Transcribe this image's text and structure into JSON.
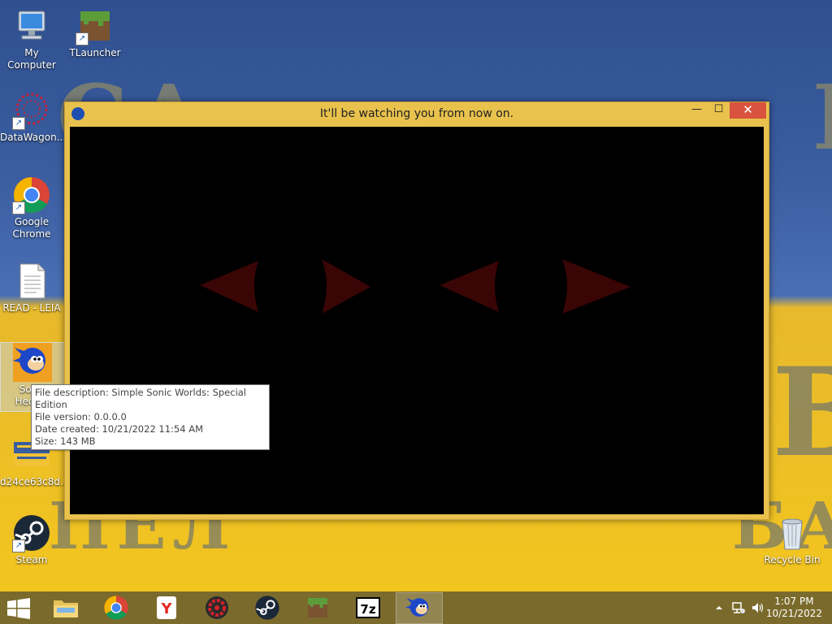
{
  "desktop": {
    "icons": [
      {
        "label": "My Computer"
      },
      {
        "label": "TLauncher"
      },
      {
        "label": "DataWagon..."
      },
      {
        "label": "Google Chrome"
      },
      {
        "label": "READ - LEIA"
      },
      {
        "label": "Sonic Hedg..."
      },
      {
        "label": "d24ce63c8d..."
      },
      {
        "label": "Steam"
      },
      {
        "label": "Recycle Bin"
      }
    ]
  },
  "window": {
    "title": "It'll be watching you from now on.",
    "minimize": "—",
    "maximize": "☐",
    "close": "✕"
  },
  "tooltip": {
    "line1": "File description: Simple Sonic Worlds: Special Edition",
    "line2": "File version: 0.0.0.0",
    "line3": "Date created: 10/21/2022 11:54 AM",
    "line4": "Size: 143 MB"
  },
  "taskbar": {
    "apps": [
      "file-explorer",
      "google-chrome",
      "yandex-browser",
      "game-app",
      "steam",
      "minecraft",
      "7-zip",
      "sonic-game"
    ],
    "seven_zip_label": "7z",
    "yandex_label": "Y",
    "clock_time": "1:07 PM",
    "clock_date": "10/21/2022"
  },
  "colors": {
    "window_frame": "#e9c24d",
    "close_button": "#d9533e",
    "eyes": "#3a0505"
  }
}
